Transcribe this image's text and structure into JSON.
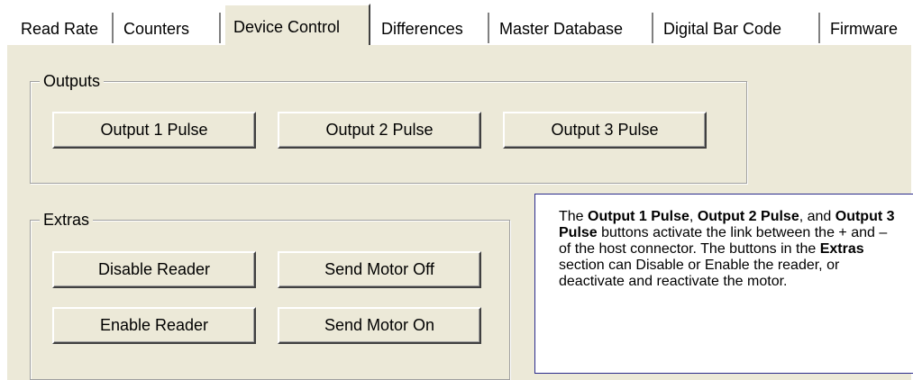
{
  "tabs": [
    {
      "label": "Read Rate",
      "active": false
    },
    {
      "label": "Counters",
      "active": false
    },
    {
      "label": "Device Control",
      "active": true
    },
    {
      "label": "Differences",
      "active": false
    },
    {
      "label": "Master Database",
      "active": false
    },
    {
      "label": "Digital Bar Code",
      "active": false
    },
    {
      "label": "Firmware",
      "active": false
    }
  ],
  "outputs": {
    "title": "Outputs",
    "buttons": [
      "Output 1 Pulse",
      "Output 2 Pulse",
      "Output 3 Pulse"
    ]
  },
  "extras": {
    "title": "Extras",
    "buttons": [
      "Disable Reader",
      "Send Motor Off",
      "Enable Reader",
      "Send Motor On"
    ]
  },
  "callout": {
    "t1": "The ",
    "b1": "Output 1 Pulse",
    "t2": ", ",
    "b2": "Output 2 Pulse",
    "t3": ", and ",
    "b3": "Output 3 Pulse",
    "t4": " buttons activate the link between the + and – of the host connector. The buttons in the ",
    "b4": "Extras",
    "t5": " section can Disable or Enable the reader, or deactivate and reactivate the motor."
  },
  "colors": {
    "panel": "#ece9d8",
    "callout_border": "#2b2b8c"
  }
}
